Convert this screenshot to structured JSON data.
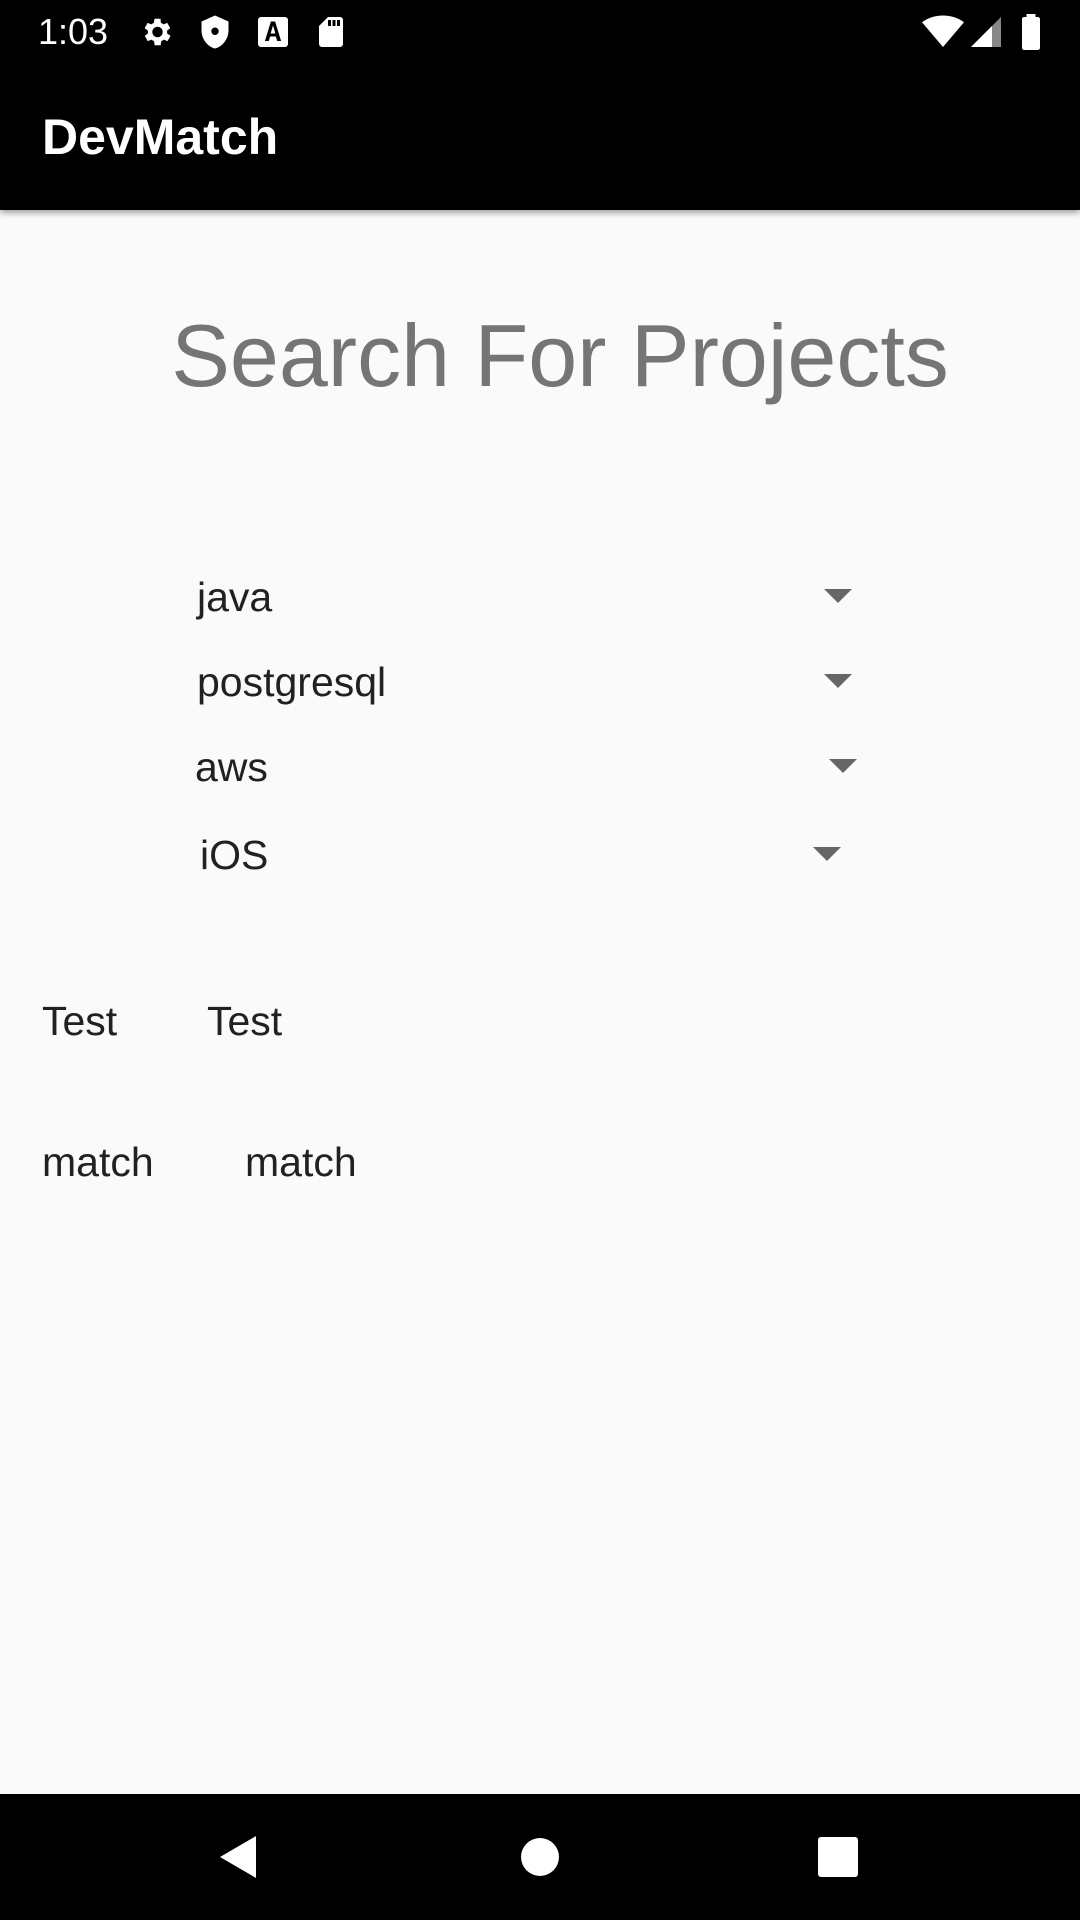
{
  "status_bar": {
    "time": "1:03",
    "left_icons": [
      "settings-icon",
      "shield-icon",
      "font-a-icon",
      "sd-card-icon"
    ],
    "right_icons": [
      "wifi-icon",
      "cell-signal-icon",
      "battery-icon"
    ]
  },
  "app_bar": {
    "title": "DevMatch"
  },
  "main": {
    "heading": "Search For Projects",
    "spinners": [
      {
        "value": "java"
      },
      {
        "value": "postgresql"
      },
      {
        "value": "aws"
      },
      {
        "value": "iOS"
      }
    ],
    "results": [
      {
        "left": "Test",
        "right": "Test"
      },
      {
        "left": "match",
        "right": "match"
      }
    ]
  },
  "nav_bar": {
    "buttons": [
      "back-icon",
      "home-icon",
      "recents-icon"
    ]
  },
  "colors": {
    "bars": "#000000",
    "background": "#fafafa",
    "heading": "#757575",
    "text": "#212121",
    "arrow": "#666666"
  }
}
